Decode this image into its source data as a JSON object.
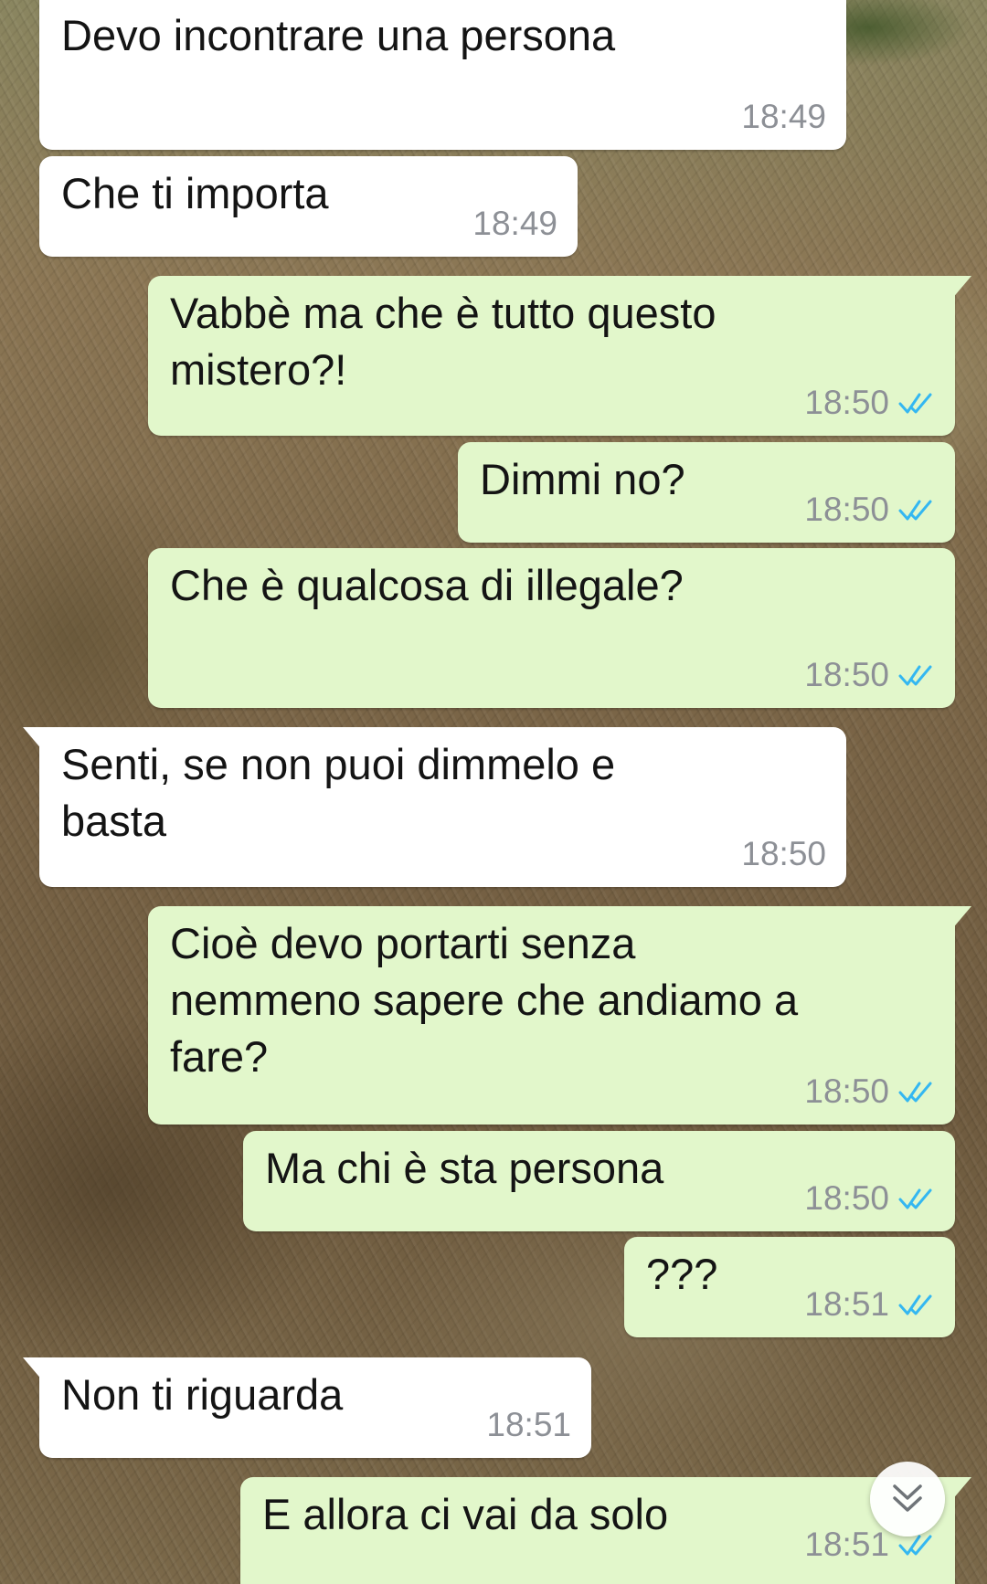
{
  "colors": {
    "incoming_bubble": "#ffffff",
    "outgoing_bubble": "#e2f7cb",
    "timestamp": "#8d9096",
    "read_receipt": "#34b7f1"
  },
  "messages": [
    {
      "direction": "incoming",
      "text": "Devo incontrare una persona",
      "time": "18:49"
    },
    {
      "direction": "incoming",
      "text": "Che ti importa",
      "time": "18:49"
    },
    {
      "direction": "outgoing",
      "text": "Vabbè ma che è tutto questo\nmistero?!",
      "time": "18:50",
      "status": "read"
    },
    {
      "direction": "outgoing",
      "text": "Dimmi no?",
      "time": "18:50",
      "status": "read"
    },
    {
      "direction": "outgoing",
      "text": "Che è qualcosa di illegale?",
      "time": "18:50",
      "status": "read"
    },
    {
      "direction": "incoming",
      "text": "Senti, se non puoi dimmelo e\nbasta",
      "time": "18:50"
    },
    {
      "direction": "outgoing",
      "text": "Cioè devo portarti senza\nnemmeno sapere che andiamo a\nfare?",
      "time": "18:50",
      "status": "read"
    },
    {
      "direction": "outgoing",
      "text": "Ma chi è sta persona",
      "time": "18:50",
      "status": "read"
    },
    {
      "direction": "outgoing",
      "text": "???",
      "time": "18:51",
      "status": "read"
    },
    {
      "direction": "incoming",
      "text": "Non ti riguarda",
      "time": "18:51"
    },
    {
      "direction": "outgoing",
      "text": "E allora ci vai da solo",
      "time": "18:51",
      "status": "read"
    }
  ],
  "scroll_down_button": {
    "icon": "double-chevron-down-icon"
  }
}
